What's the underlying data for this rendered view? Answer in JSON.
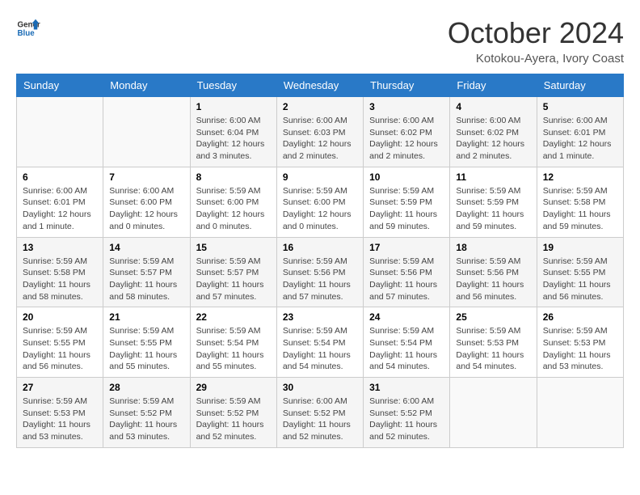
{
  "header": {
    "logo_general": "General",
    "logo_blue": "Blue",
    "month_title": "October 2024",
    "location": "Kotokou-Ayera, Ivory Coast"
  },
  "days_of_week": [
    "Sunday",
    "Monday",
    "Tuesday",
    "Wednesday",
    "Thursday",
    "Friday",
    "Saturday"
  ],
  "weeks": [
    [
      {
        "day": "",
        "info": ""
      },
      {
        "day": "",
        "info": ""
      },
      {
        "day": "1",
        "info": "Sunrise: 6:00 AM\nSunset: 6:04 PM\nDaylight: 12 hours and 3 minutes."
      },
      {
        "day": "2",
        "info": "Sunrise: 6:00 AM\nSunset: 6:03 PM\nDaylight: 12 hours and 2 minutes."
      },
      {
        "day": "3",
        "info": "Sunrise: 6:00 AM\nSunset: 6:02 PM\nDaylight: 12 hours and 2 minutes."
      },
      {
        "day": "4",
        "info": "Sunrise: 6:00 AM\nSunset: 6:02 PM\nDaylight: 12 hours and 2 minutes."
      },
      {
        "day": "5",
        "info": "Sunrise: 6:00 AM\nSunset: 6:01 PM\nDaylight: 12 hours and 1 minute."
      }
    ],
    [
      {
        "day": "6",
        "info": "Sunrise: 6:00 AM\nSunset: 6:01 PM\nDaylight: 12 hours and 1 minute."
      },
      {
        "day": "7",
        "info": "Sunrise: 6:00 AM\nSunset: 6:00 PM\nDaylight: 12 hours and 0 minutes."
      },
      {
        "day": "8",
        "info": "Sunrise: 5:59 AM\nSunset: 6:00 PM\nDaylight: 12 hours and 0 minutes."
      },
      {
        "day": "9",
        "info": "Sunrise: 5:59 AM\nSunset: 6:00 PM\nDaylight: 12 hours and 0 minutes."
      },
      {
        "day": "10",
        "info": "Sunrise: 5:59 AM\nSunset: 5:59 PM\nDaylight: 11 hours and 59 minutes."
      },
      {
        "day": "11",
        "info": "Sunrise: 5:59 AM\nSunset: 5:59 PM\nDaylight: 11 hours and 59 minutes."
      },
      {
        "day": "12",
        "info": "Sunrise: 5:59 AM\nSunset: 5:58 PM\nDaylight: 11 hours and 59 minutes."
      }
    ],
    [
      {
        "day": "13",
        "info": "Sunrise: 5:59 AM\nSunset: 5:58 PM\nDaylight: 11 hours and 58 minutes."
      },
      {
        "day": "14",
        "info": "Sunrise: 5:59 AM\nSunset: 5:57 PM\nDaylight: 11 hours and 58 minutes."
      },
      {
        "day": "15",
        "info": "Sunrise: 5:59 AM\nSunset: 5:57 PM\nDaylight: 11 hours and 57 minutes."
      },
      {
        "day": "16",
        "info": "Sunrise: 5:59 AM\nSunset: 5:56 PM\nDaylight: 11 hours and 57 minutes."
      },
      {
        "day": "17",
        "info": "Sunrise: 5:59 AM\nSunset: 5:56 PM\nDaylight: 11 hours and 57 minutes."
      },
      {
        "day": "18",
        "info": "Sunrise: 5:59 AM\nSunset: 5:56 PM\nDaylight: 11 hours and 56 minutes."
      },
      {
        "day": "19",
        "info": "Sunrise: 5:59 AM\nSunset: 5:55 PM\nDaylight: 11 hours and 56 minutes."
      }
    ],
    [
      {
        "day": "20",
        "info": "Sunrise: 5:59 AM\nSunset: 5:55 PM\nDaylight: 11 hours and 56 minutes."
      },
      {
        "day": "21",
        "info": "Sunrise: 5:59 AM\nSunset: 5:55 PM\nDaylight: 11 hours and 55 minutes."
      },
      {
        "day": "22",
        "info": "Sunrise: 5:59 AM\nSunset: 5:54 PM\nDaylight: 11 hours and 55 minutes."
      },
      {
        "day": "23",
        "info": "Sunrise: 5:59 AM\nSunset: 5:54 PM\nDaylight: 11 hours and 54 minutes."
      },
      {
        "day": "24",
        "info": "Sunrise: 5:59 AM\nSunset: 5:54 PM\nDaylight: 11 hours and 54 minutes."
      },
      {
        "day": "25",
        "info": "Sunrise: 5:59 AM\nSunset: 5:53 PM\nDaylight: 11 hours and 54 minutes."
      },
      {
        "day": "26",
        "info": "Sunrise: 5:59 AM\nSunset: 5:53 PM\nDaylight: 11 hours and 53 minutes."
      }
    ],
    [
      {
        "day": "27",
        "info": "Sunrise: 5:59 AM\nSunset: 5:53 PM\nDaylight: 11 hours and 53 minutes."
      },
      {
        "day": "28",
        "info": "Sunrise: 5:59 AM\nSunset: 5:52 PM\nDaylight: 11 hours and 53 minutes."
      },
      {
        "day": "29",
        "info": "Sunrise: 5:59 AM\nSunset: 5:52 PM\nDaylight: 11 hours and 52 minutes."
      },
      {
        "day": "30",
        "info": "Sunrise: 6:00 AM\nSunset: 5:52 PM\nDaylight: 11 hours and 52 minutes."
      },
      {
        "day": "31",
        "info": "Sunrise: 6:00 AM\nSunset: 5:52 PM\nDaylight: 11 hours and 52 minutes."
      },
      {
        "day": "",
        "info": ""
      },
      {
        "day": "",
        "info": ""
      }
    ]
  ]
}
